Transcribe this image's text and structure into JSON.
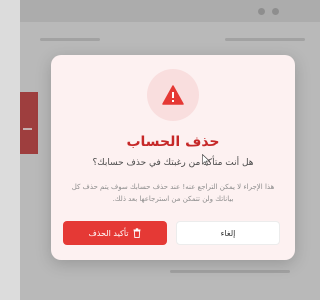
{
  "dialog": {
    "title": "حذف الحساب",
    "question": "هل أنت متأكد من رغبتك في حذف حسابك؟",
    "note": "هذا الإجراء لا يمكن التراجع عنه! عند حذف حسابك سوف يتم حذف كل بياناتك ولن تتمكن من استرجاعها بعد ذلك.",
    "icon": "warning-icon",
    "cancel_label": "إلغاء",
    "confirm_label": "تأكيد الحذف",
    "confirm_icon": "trash-icon"
  },
  "colors": {
    "accent": "#e53935",
    "title": "#c62828",
    "dialog_bg": "#fdf1f1",
    "icon_bg": "#f9dede"
  }
}
